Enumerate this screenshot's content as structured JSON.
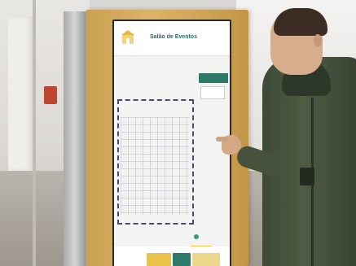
{
  "kiosk": {
    "brand_title": "Salão de Eventos",
    "brand_subtitle": ""
  }
}
